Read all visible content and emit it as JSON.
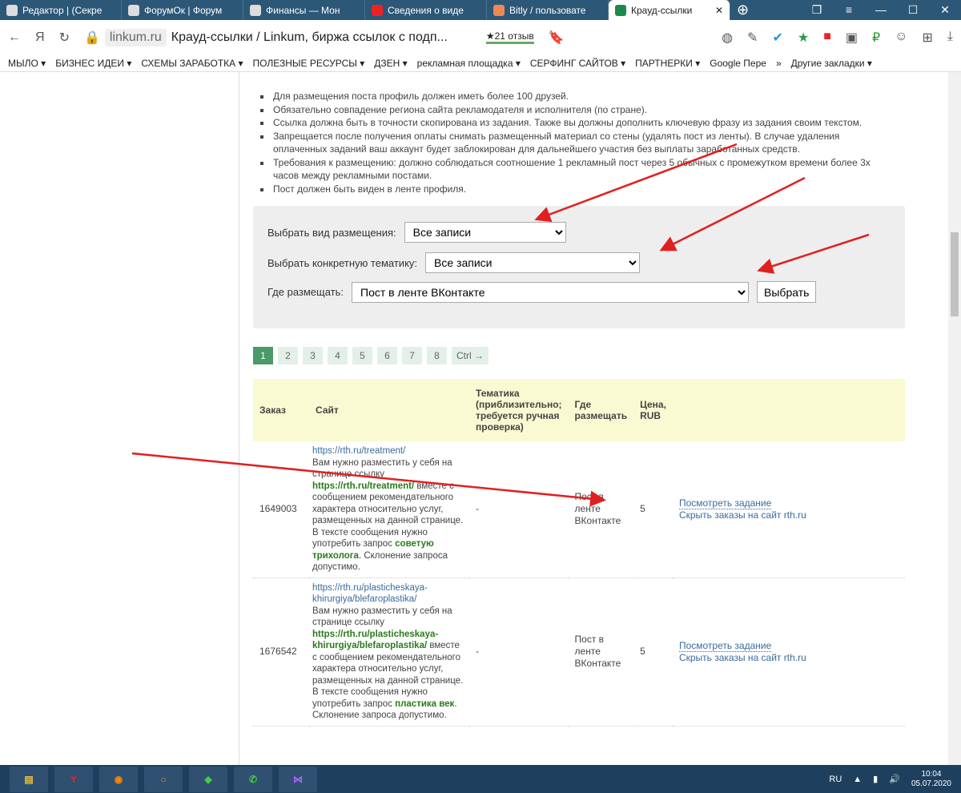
{
  "browser": {
    "tabs": [
      "Редактор | (Секре",
      "ФорумОк | Форум",
      "Финансы — Мон",
      "Сведения о виде",
      "Bitly / пользовате",
      "Крауд-ссылки"
    ],
    "domain": "linkum.ru",
    "title": "Крауд-ссылки / Linkum, биржа ссылок с подп...",
    "reviews": "★21 отзыв",
    "bookmarks": [
      "МЫЛО ▾",
      "БИЗНЕС ИДЕИ ▾",
      "СХЕМЫ ЗАРАБОТКА ▾",
      "ПОЛЕЗНЫЕ РЕСУРСЫ ▾",
      "ДЗЕН ▾",
      "рекламная площадка ▾",
      "СЕРФИНГ САЙТОВ ▾",
      "ПАРТНЕРКИ ▾",
      "Google Пере",
      "»",
      "Другие закладки ▾"
    ]
  },
  "rules": [
    "Для размещения поста профиль должен иметь более 100 друзей.",
    "Обязательно совпадение региона сайта рекламодателя и исполнителя (по стране).",
    "Ссылка должна быть в точности скопирована из задания. Также вы должны дополнить ключевую фразу из задания своим текстом.",
    "Запрещается после получения оплаты снимать размещенный материал со стены (удалять пост из ленты). В случае удаления оплаченных заданий ваш аккаунт будет заблокирован для дальнейшего участия без выплаты заработанных средств.",
    "Требования к размещению: должно соблюдаться соотношение 1 рекламный пост через 5 обычных с промежутком времени более 3х часов между рекламными постами.",
    "Пост должен быть виден в ленте профиля."
  ],
  "filter": {
    "type_label": "Выбрать вид размещения:",
    "type_value": "Все записи",
    "topic_label": "Выбрать конкретную тематику:",
    "topic_value": "Все записи",
    "where_label": "Где размещать:",
    "where_value": "Пост в ленте ВКонтакте",
    "submit": "Выбрать"
  },
  "pager": [
    "1",
    "2",
    "3",
    "4",
    "5",
    "6",
    "7",
    "8",
    "Ctrl →"
  ],
  "table": {
    "headers": [
      "Заказ",
      "Сайт",
      "Тематика (приблизительно; требуется ручная проверка)",
      "Где размещать",
      "Цена, RUB",
      ""
    ],
    "rows": [
      {
        "id": "1649003",
        "url": "https://rth.ru/treatment/",
        "t1": "Вам нужно разместить у себя на странице ссылку ",
        "link": "https://rth.ru/treatment/",
        "t2": " вместе с сообщением рекомендательного характера относительно услуг, размещенных на данной странице. В тексте сообщения нужно употребить запрос ",
        "kw": "советую трихолога",
        "t3": ". Склонение запроса допустимо.",
        "topic": "-",
        "where": "Пост в ленте ВКонтакте",
        "price": "5",
        "view": "Посмотреть задание",
        "hide": "Скрыть заказы на сайт rth.ru"
      },
      {
        "id": "1676542",
        "url": "https://rth.ru/plasticheskaya-khirurgiya/blefaroplastika/",
        "t1": "Вам нужно разместить у себя на странице ссылку ",
        "link": "https://rth.ru/plasticheskaya-khirurgiya/blefaroplastika/",
        "t2": " вместе с сообщением рекомендательного характера относительно услуг, размещенных на данной странице. В тексте сообщения нужно употребить запрос ",
        "kw": "пластика век",
        "t3": ". Склонение запроса допустимо.",
        "topic": "-",
        "where": "Пост в ленте ВКонтакте",
        "price": "5",
        "view": "Посмотреть задание",
        "hide": "Скрыть заказы на сайт rth.ru"
      }
    ]
  },
  "taskbar": {
    "lang": "RU",
    "time": "10:04",
    "date": "05.07.2020"
  },
  "colors": {
    "accent": "#4a9a6a",
    "link": "#3a6a9c",
    "arrow": "#e02020"
  }
}
